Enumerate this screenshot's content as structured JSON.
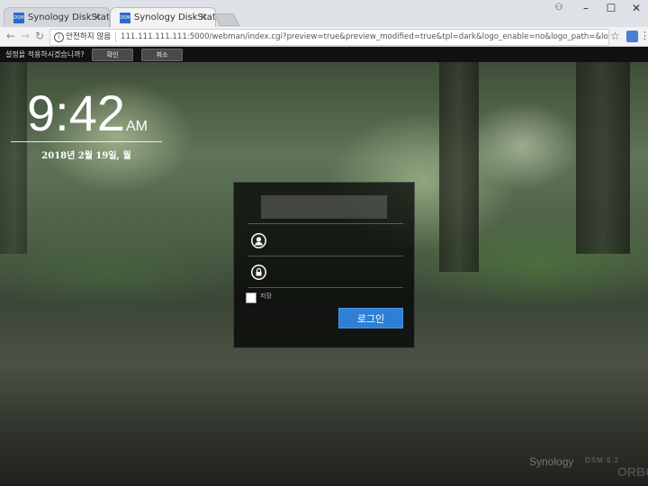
{
  "browser": {
    "tabs": [
      {
        "favicon": "DSM",
        "title": "Synology DiskStation -"
      },
      {
        "favicon": "DSM",
        "title": "Synology DiskStation -"
      }
    ],
    "omnibox": {
      "security_label": "안전하지 않음",
      "url": "111.111.111.111:5000/webman/index.cgi?preview=true&preview_modified=true&tpl=dark&logo_enable=no&logo_path=&logo_ext=&lo..."
    }
  },
  "confirm_bar": {
    "question": "설정을 적용하시겠습니까?",
    "confirm_label": "확인",
    "cancel_label": "취소"
  },
  "clock": {
    "time": "9:42",
    "ampm": "AM",
    "date": "2018년 2월 19일, 월"
  },
  "login": {
    "remember_label": "저장",
    "login_label": "로그인"
  },
  "footer": {
    "brand": "Synology",
    "product": "DSM 6.2",
    "watermark": "ORBO"
  },
  "colors": {
    "accent": "#2f7fd4",
    "panel": "#000000"
  },
  "icons": [
    "user-icon",
    "lock-icon",
    "info-icon",
    "star-icon",
    "back-icon",
    "forward-icon",
    "reload-icon"
  ]
}
